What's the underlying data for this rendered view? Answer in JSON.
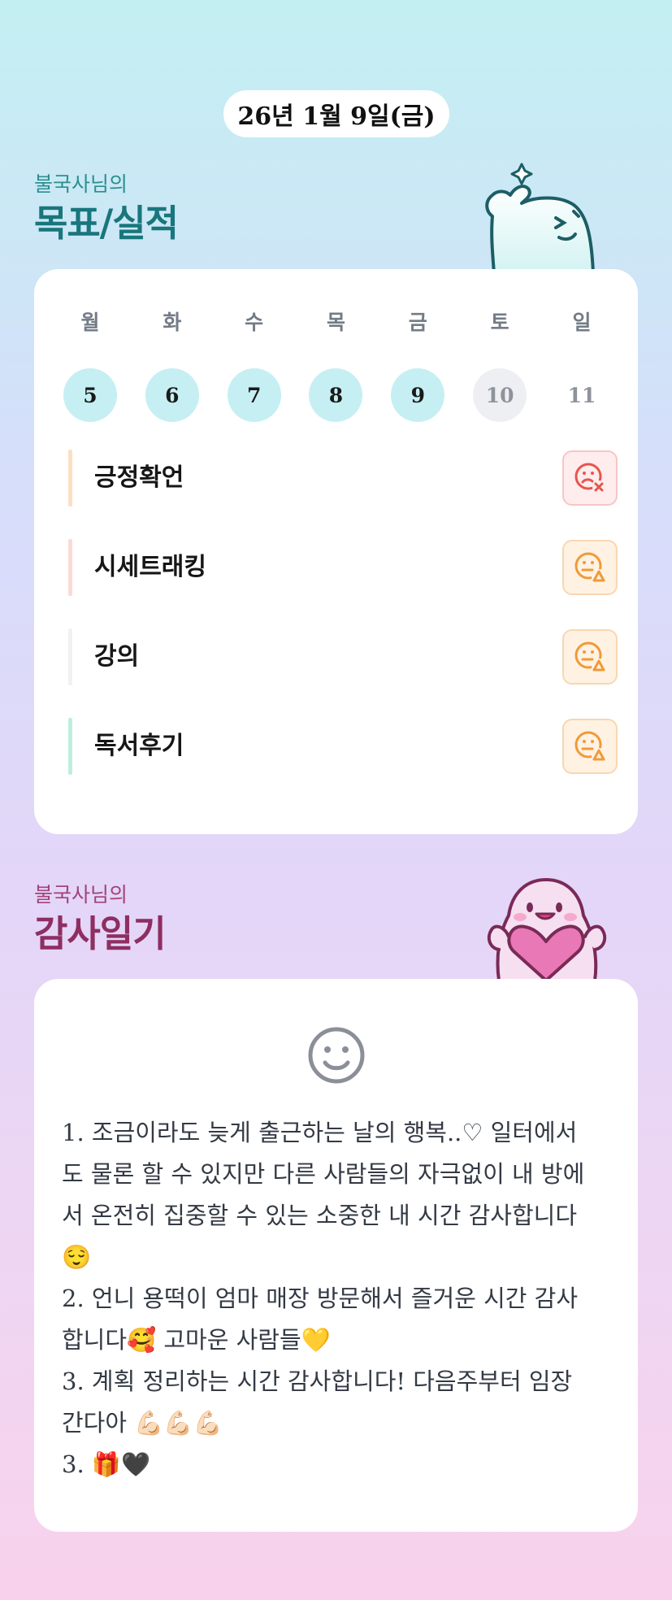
{
  "date": "26년 1월 9일(금)",
  "goals_section": {
    "subtitle": "불국사님의",
    "title": "목표/실적"
  },
  "week": {
    "days": [
      {
        "weekday": "월",
        "date": "5",
        "state": "done"
      },
      {
        "weekday": "화",
        "date": "6",
        "state": "done"
      },
      {
        "weekday": "수",
        "date": "7",
        "state": "done"
      },
      {
        "weekday": "목",
        "date": "8",
        "state": "done"
      },
      {
        "weekday": "금",
        "date": "9",
        "state": "done"
      },
      {
        "weekday": "토",
        "date": "10",
        "state": "upcoming"
      },
      {
        "weekday": "일",
        "date": "11",
        "state": "upcoming"
      }
    ]
  },
  "goals": [
    {
      "label": "긍정확언",
      "bar_color": "#fbe0c3",
      "status_icon": "sad-face-x-icon",
      "status_color": "#e4564f"
    },
    {
      "label": "시세트래킹",
      "bar_color": "#fadad7",
      "status_icon": "neutral-face-triangle-icon",
      "status_color": "#f09a38"
    },
    {
      "label": "강의",
      "bar_color": "#f1f1f1",
      "status_icon": "neutral-face-triangle-icon",
      "status_color": "#f09a38"
    },
    {
      "label": "독서후기",
      "bar_color": "#bfeedd",
      "status_icon": "neutral-face-triangle-icon",
      "status_color": "#f09a38"
    }
  ],
  "gratitude_section": {
    "subtitle": "불국사님의",
    "title": "감사일기",
    "mood_icon": "smiley-face-icon",
    "entries": [
      "1. 조금이라도 늦게 출근하는 날의 행복..♡ 일터에서도 물론 할 수 있지만 다른 사람들의 자극없이 내 방에서 온전히 집중할 수 있는 소중한 내 시간 감사합니다😌",
      "2. 언니 용떡이 엄마 매장 방문해서 즐거운 시간 감사합니다🥰 고마운 사람들💛",
      "3. 계획 정리하는 시간 감사합니다! 다음주부터 임장 간다아 💪🏻💪🏻💪🏻",
      "3. 🎁🖤"
    ]
  },
  "colors": {
    "teal_title": "#18767c",
    "magenta_title": "#8e2e62",
    "done_circle": "#c6eff3"
  }
}
